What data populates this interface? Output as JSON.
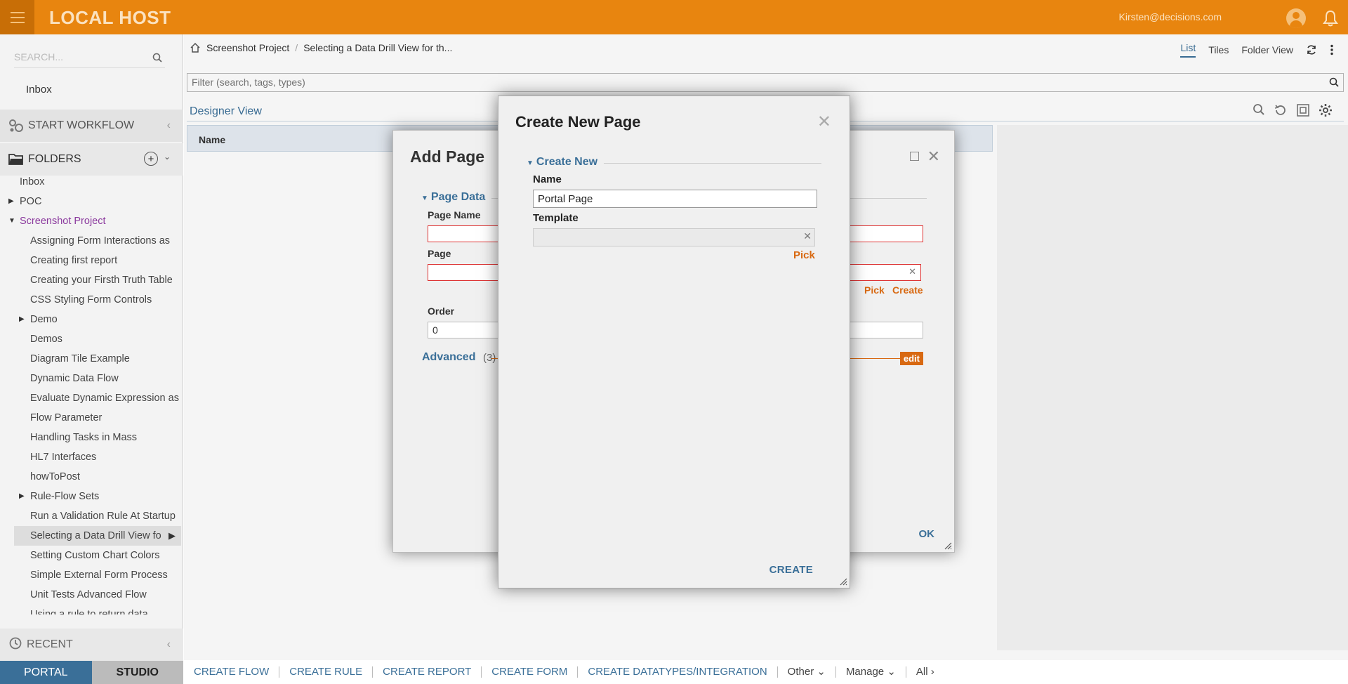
{
  "app": {
    "title": "LOCAL HOST",
    "user_email": "Kirsten@decisions.com"
  },
  "sidebar": {
    "search_placeholder": "SEARCH...",
    "inbox": "Inbox",
    "start_workflow": "START WORKFLOW",
    "folders": "FOLDERS",
    "tree": [
      {
        "label": "Inbox",
        "indent": 0,
        "arrow": ""
      },
      {
        "label": "POC",
        "indent": 0,
        "arrow": "right"
      },
      {
        "label": "Screenshot Project",
        "indent": 0,
        "arrow": "down",
        "purple": true
      },
      {
        "label": "Assigning Form Interactions as",
        "indent": 1,
        "arrow": ""
      },
      {
        "label": "Creating first report",
        "indent": 1,
        "arrow": ""
      },
      {
        "label": "Creating your Firsth Truth Table",
        "indent": 1,
        "arrow": ""
      },
      {
        "label": "CSS Styling Form Controls",
        "indent": 1,
        "arrow": ""
      },
      {
        "label": "Demo",
        "indent": 1,
        "arrow": "right"
      },
      {
        "label": "Demos",
        "indent": 1,
        "arrow": ""
      },
      {
        "label": "Diagram Tile Example",
        "indent": 1,
        "arrow": ""
      },
      {
        "label": "Dynamic Data Flow",
        "indent": 1,
        "arrow": ""
      },
      {
        "label": "Evaluate Dynamic Expression as",
        "indent": 1,
        "arrow": ""
      },
      {
        "label": "Flow Parameter",
        "indent": 1,
        "arrow": ""
      },
      {
        "label": "Handling Tasks in Mass",
        "indent": 1,
        "arrow": ""
      },
      {
        "label": "HL7 Interfaces",
        "indent": 1,
        "arrow": ""
      },
      {
        "label": "howToPost",
        "indent": 1,
        "arrow": ""
      },
      {
        "label": "Rule-Flow Sets",
        "indent": 1,
        "arrow": "right"
      },
      {
        "label": "Run a Validation Rule At Startup",
        "indent": 1,
        "arrow": ""
      },
      {
        "label": "Selecting a Data Drill View fo",
        "indent": 1,
        "arrow": "",
        "active": true
      },
      {
        "label": "Setting Custom Chart Colors",
        "indent": 1,
        "arrow": ""
      },
      {
        "label": "Simple External Form Process",
        "indent": 1,
        "arrow": ""
      },
      {
        "label": "Unit Tests Advanced Flow",
        "indent": 1,
        "arrow": ""
      },
      {
        "label": "Using a rule to return data",
        "indent": 1,
        "arrow": ""
      }
    ],
    "recent": "RECENT",
    "tab_portal": "PORTAL",
    "tab_studio": "STUDIO"
  },
  "breadcrumb": {
    "items": [
      "Screenshot Project",
      "Selecting a Data Drill View for th..."
    ],
    "sep": "/"
  },
  "view_tabs": [
    "List",
    "Tiles",
    "Folder View"
  ],
  "filter_placeholder": "Filter (search, tags, types)",
  "designer": {
    "title": "Designer View",
    "column_name": "Name"
  },
  "bottom_actions": [
    "CREATE FLOW",
    "CREATE RULE",
    "CREATE REPORT",
    "CREATE FORM",
    "CREATE DATATYPES/INTEGRATION"
  ],
  "bottom_menus": [
    "Other",
    "Manage",
    "All"
  ],
  "add_page": {
    "title": "Add Page",
    "group": "Page Data",
    "page_name_label": "Page Name",
    "page_label": "Page",
    "pick": "Pick",
    "create": "Create",
    "order_label": "Order",
    "order_value": "0",
    "advanced": "Advanced",
    "advanced_count": "(3)",
    "edit": "edit",
    "ok": "OK"
  },
  "create_new_page": {
    "title": "Create New Page",
    "group": "Create New",
    "name_label": "Name",
    "name_value": "Portal Page",
    "template_label": "Template",
    "pick": "Pick",
    "create": "CREATE"
  }
}
